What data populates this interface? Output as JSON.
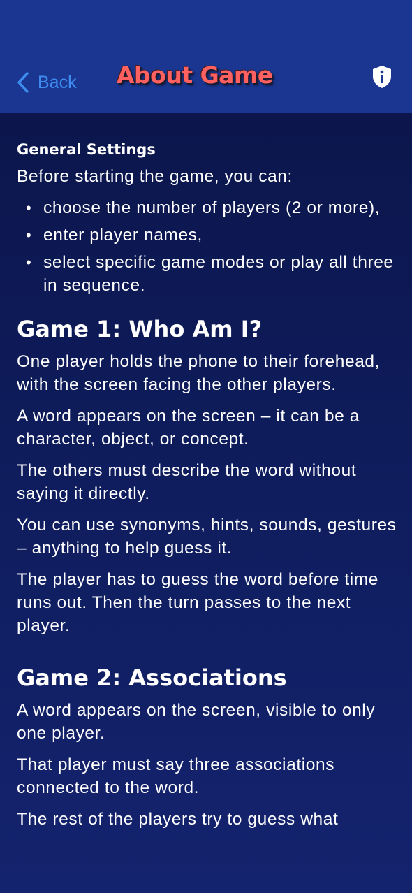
{
  "header": {
    "back_label": "Back",
    "title": "About Game",
    "info_icon": "shield-info-icon"
  },
  "general": {
    "heading": "General Settings",
    "intro": "Before starting the game, you can:",
    "items": [
      "choose the number of players (2 or more),",
      "enter player names,",
      "select specific game modes or play all three in sequence."
    ]
  },
  "game1": {
    "heading": "Game 1: Who Am I?",
    "paragraphs": [
      "One player holds the phone to their forehead, with the screen facing the other players.",
      "A word appears on the screen – it can be a character, object, or concept.",
      "The others must describe the word without saying it directly.",
      "You can use synonyms, hints, sounds, gestures – anything to help guess it.",
      "The player has to guess the word before time runs out. Then the turn passes to the next player."
    ]
  },
  "game2": {
    "heading": "Game 2: Associations",
    "paragraphs": [
      "A word appears on the screen, visible to only one player.",
      "That player must say three associations connected to the word.",
      "The rest of the players try to guess what"
    ]
  },
  "colors": {
    "header_bg": "#1a3690",
    "title": "#ff6161",
    "back": "#3f8cf0",
    "body_bg": "#0b1447"
  }
}
